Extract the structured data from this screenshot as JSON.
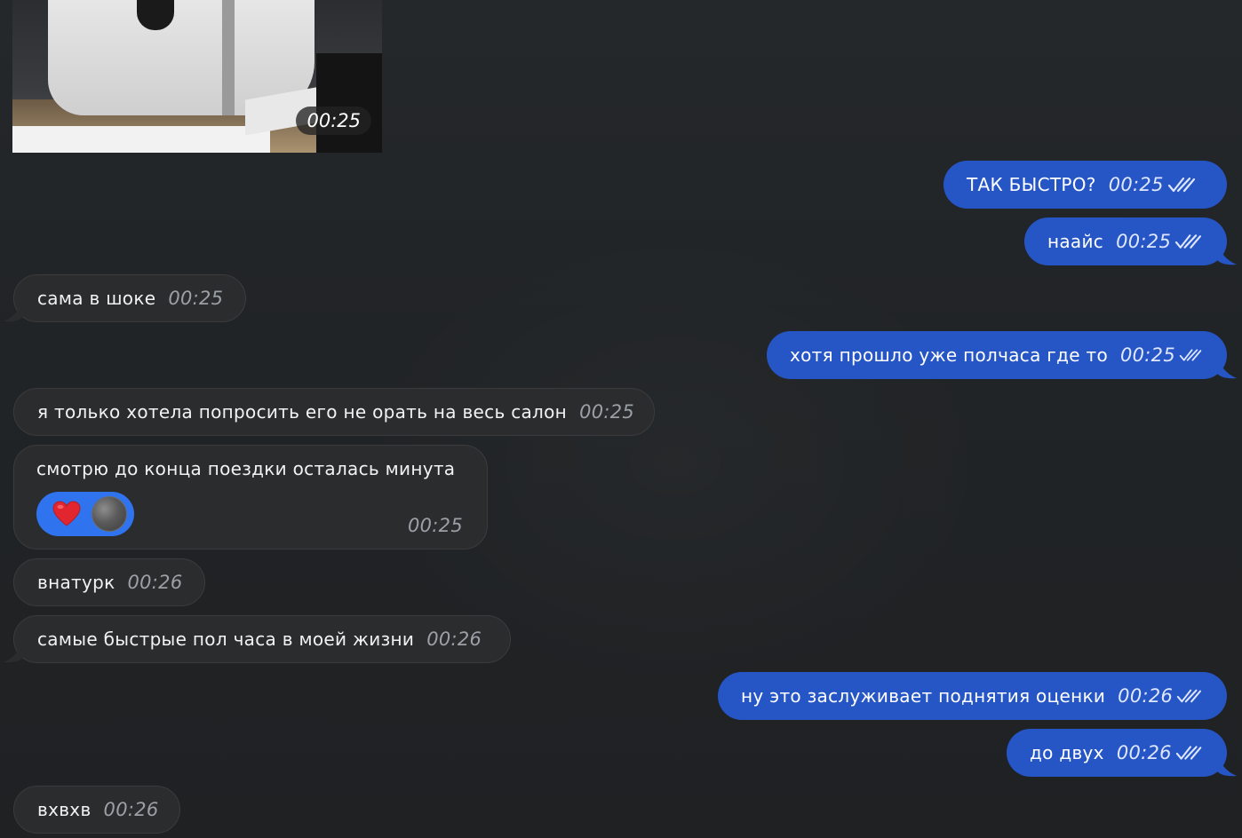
{
  "media": {
    "time": "00:25"
  },
  "messages": [
    {
      "id": "m1",
      "side": "out",
      "text": "ТАК БЫСТРО?",
      "time": "00:25",
      "read": true
    },
    {
      "id": "m2",
      "side": "out",
      "text": "наайс",
      "time": "00:25",
      "read": true
    },
    {
      "id": "m3",
      "side": "in",
      "text": "сама в шоке",
      "time": "00:25"
    },
    {
      "id": "m4",
      "side": "out",
      "text": "хотя прошло уже полчаса где то",
      "time": "00:25",
      "read": true
    },
    {
      "id": "m5",
      "side": "in",
      "text": "я только хотела попросить его не орать на весь салон",
      "time": "00:25"
    },
    {
      "id": "m6",
      "side": "in",
      "text": "смотрю до конца поездки осталась минута",
      "time": "00:25",
      "reaction": "heart"
    },
    {
      "id": "m7",
      "side": "in",
      "text": "внатурк",
      "time": "00:26"
    },
    {
      "id": "m8",
      "side": "in",
      "text": "самые быстрые пол часа в моей жизни",
      "time": "00:26"
    },
    {
      "id": "m9",
      "side": "out",
      "text": "ну это заслуживает поднятия оценки",
      "time": "00:26",
      "read": true
    },
    {
      "id": "m10",
      "side": "out",
      "text": "до двух",
      "time": "00:26",
      "read": true
    },
    {
      "id": "m11",
      "side": "in",
      "text": "вхвхв",
      "time": "00:26"
    }
  ],
  "colors": {
    "background": "#212426",
    "incoming_bubble": "#2b2c2e",
    "outgoing_bubble": "#2656c6",
    "reaction_bg": "#2f74ee"
  },
  "icons": {
    "read_receipt": "double-check-icon",
    "reaction": "heart-icon"
  }
}
